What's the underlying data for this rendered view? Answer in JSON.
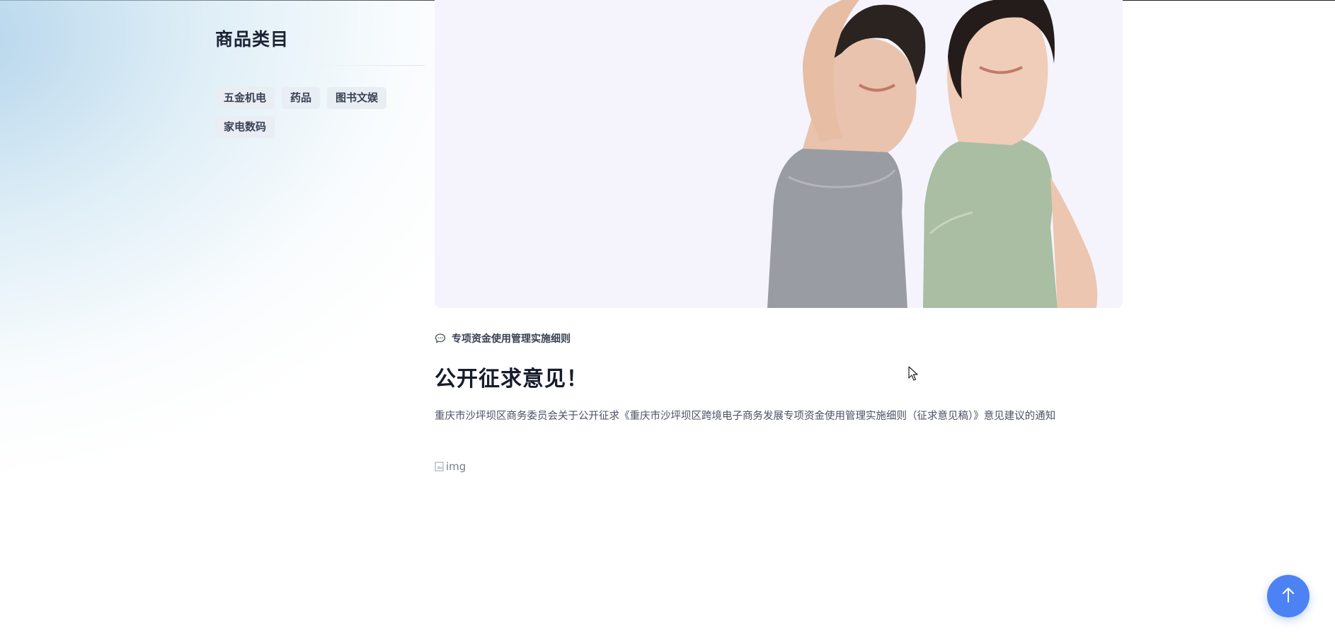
{
  "sidebar": {
    "title": "商品类目",
    "tags": [
      {
        "label": "五金机电"
      },
      {
        "label": "药品"
      },
      {
        "label": "图书文娱"
      },
      {
        "label": "家电数码"
      }
    ]
  },
  "article": {
    "category": "专项资金使用管理实施细则",
    "category_icon": "comment-icon",
    "title": "公开征求意见！",
    "description": "重庆市沙坪坝区商务委员会关于公开征求《重庆市沙坪坝区跨境电子商务发展专项资金使用管理实施细则（征求意见稿）》意见建议的通知",
    "image_alt": "img"
  },
  "back_to_top_icon": "arrow-up-icon",
  "colors": {
    "accent": "#4d82f5",
    "tag_bg": "#e8eef4",
    "hero_bg": "#f5f4fd"
  }
}
